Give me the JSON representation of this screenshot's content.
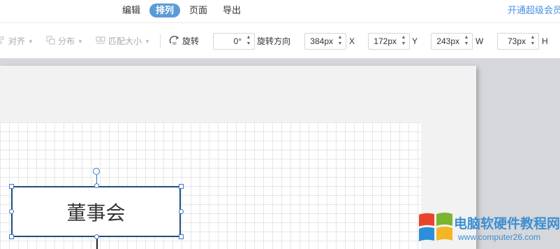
{
  "menubar": {
    "items": [
      {
        "label": "编辑",
        "active": false
      },
      {
        "label": "排列",
        "active": true
      },
      {
        "label": "页面",
        "active": false
      },
      {
        "label": "导出",
        "active": false
      }
    ],
    "vip_link": "开通超级会员"
  },
  "toolbar": {
    "align": {
      "label": "对齐",
      "icon": "align-icon"
    },
    "distribute": {
      "label": "分布",
      "icon": "distribute-icon"
    },
    "match_size": {
      "label": "匹配大小",
      "icon": "match-size-icon"
    },
    "rotate": {
      "label": "旋转",
      "icon": "rotate-icon"
    },
    "rotation_value": "0°",
    "rotation_dir_label": "旋转方向",
    "x_value": "384px",
    "x_label": "X",
    "y_value": "172px",
    "y_label": "Y",
    "w_value": "243px",
    "w_label": "W",
    "h_value": "73px",
    "h_label": "H"
  },
  "canvas": {
    "shape_text": "董事会",
    "shape_border_color": "#1f4e79",
    "handle_color": "#3c78c8"
  },
  "watermark": {
    "title": "电脑软硬件教程网",
    "url": "www.computer26.com",
    "logo": "windows-logo-icon"
  },
  "colors": {
    "accent": "#5b9bd5",
    "link": "#4a90e2"
  }
}
